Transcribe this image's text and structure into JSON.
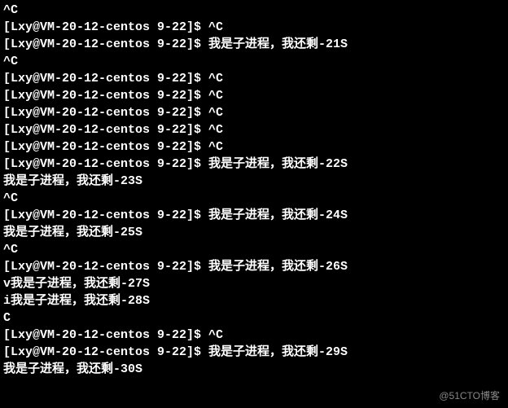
{
  "prompt": "[Lxy@VM-20-12-centos 9-22]$ ",
  "ctrl_c": "^C",
  "msg_prefix": "我是子进程，我还剩-",
  "msg_suffix": "S",
  "lines": [
    {
      "type": "text",
      "value": "^C"
    },
    {
      "type": "prompt_cmd",
      "cmd": "^C"
    },
    {
      "type": "prompt_msg",
      "n": "21"
    },
    {
      "type": "text",
      "value": "^C"
    },
    {
      "type": "prompt_cmd",
      "cmd": "^C"
    },
    {
      "type": "prompt_cmd",
      "cmd": "^C"
    },
    {
      "type": "prompt_cmd",
      "cmd": "^C"
    },
    {
      "type": "prompt_cmd",
      "cmd": "^C"
    },
    {
      "type": "prompt_cmd",
      "cmd": "^C"
    },
    {
      "type": "prompt_msg",
      "n": "22"
    },
    {
      "type": "msg",
      "prefix": "",
      "n": "23"
    },
    {
      "type": "text",
      "value": "^C"
    },
    {
      "type": "prompt_msg",
      "n": "24"
    },
    {
      "type": "msg",
      "prefix": "",
      "n": "25"
    },
    {
      "type": "text",
      "value": "^C"
    },
    {
      "type": "prompt_msg",
      "n": "26"
    },
    {
      "type": "msg",
      "prefix": "v",
      "n": "27"
    },
    {
      "type": "msg",
      "prefix": "i",
      "n": "28"
    },
    {
      "type": "text",
      "value": "C"
    },
    {
      "type": "prompt_cmd",
      "cmd": "^C"
    },
    {
      "type": "prompt_msg",
      "n": "29"
    },
    {
      "type": "msg",
      "prefix": "",
      "n": "30"
    }
  ],
  "watermark": "@51CTO博客"
}
